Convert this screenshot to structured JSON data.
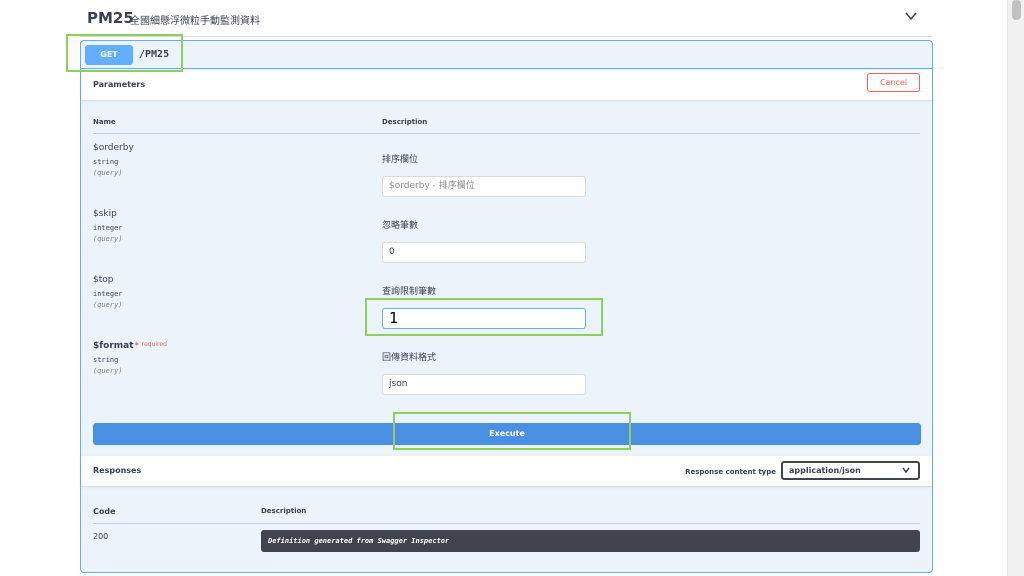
{
  "header": {
    "tag_title": "PM25",
    "tag_description": "全國細懸浮微粒手動監測資料"
  },
  "operation": {
    "method": "GET",
    "path": "/PM25"
  },
  "parameters_section": {
    "title": "Parameters",
    "cancel_label": "Cancel",
    "col_name": "Name",
    "col_description": "Description",
    "items": [
      {
        "name": "$orderby",
        "required": false,
        "type": "string",
        "in": "(query)",
        "description": "排序欄位",
        "value": "",
        "placeholder": "$orderby - 排序欄位"
      },
      {
        "name": "$skip",
        "required": false,
        "type": "integer",
        "in": "(query)",
        "description": "忽略筆數",
        "value": "0",
        "placeholder": ""
      },
      {
        "name": "$top",
        "required": false,
        "type": "integer",
        "in": "(query)",
        "description": "查詢限制筆數",
        "value": "1",
        "placeholder": ""
      },
      {
        "name": "$format",
        "required": true,
        "required_star": "*",
        "required_label": "required",
        "type": "string",
        "in": "(query)",
        "description": "回傳資料格式",
        "value": "json",
        "placeholder": ""
      }
    ],
    "execute_label": "Execute"
  },
  "responses_section": {
    "title": "Responses",
    "content_type_label": "Response content type",
    "content_type_value": "application/json",
    "col_code": "Code",
    "col_description": "Description",
    "rows": [
      {
        "code": "200",
        "description": "Definition generated from Swagger Inspector"
      }
    ]
  },
  "colors": {
    "get_blue": "#61affe",
    "execute_blue": "#4990e2",
    "cancel_red": "#ff6060",
    "highlight_green": "#8ed05b"
  },
  "icons": {
    "collapse": "chevron-down-icon",
    "select": "chevron-down-icon"
  }
}
